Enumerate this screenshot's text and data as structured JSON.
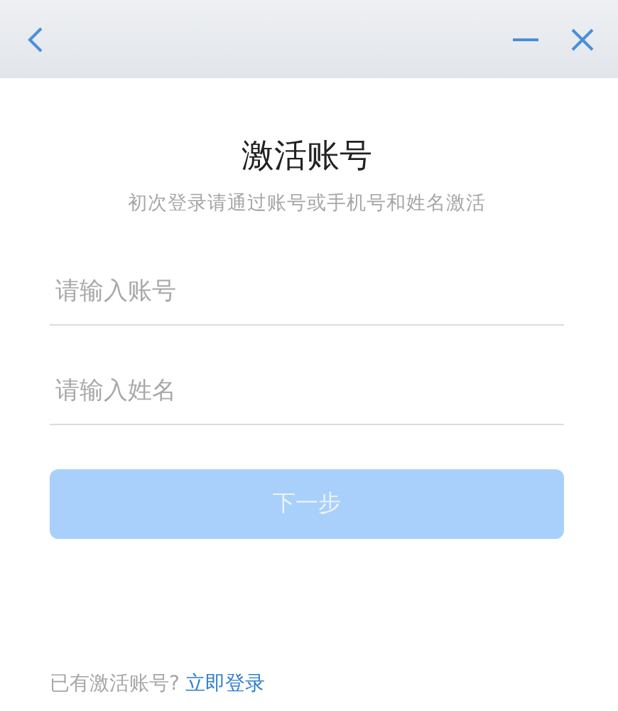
{
  "title": "激活账号",
  "subtitle": "初次登录请通过账号或手机号和姓名激活",
  "fields": [
    {
      "placeholder": "请输入账号"
    },
    {
      "placeholder": "请输入姓名"
    }
  ],
  "next_button": {
    "label": "下一步",
    "disabled": true
  },
  "footer": {
    "text": "已有激活账号?",
    "link": "立即登录"
  }
}
